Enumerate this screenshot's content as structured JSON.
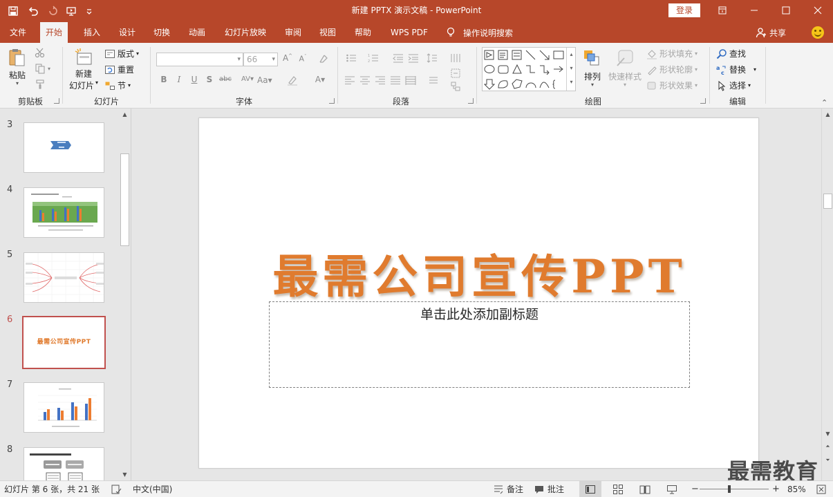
{
  "window": {
    "title": "新建 PPTX 演示文稿  -  PowerPoint",
    "login_label": "登录"
  },
  "tabs": [
    {
      "label": "文件"
    },
    {
      "label": "开始"
    },
    {
      "label": "插入"
    },
    {
      "label": "设计"
    },
    {
      "label": "切换"
    },
    {
      "label": "动画"
    },
    {
      "label": "幻灯片放映"
    },
    {
      "label": "审阅"
    },
    {
      "label": "视图"
    },
    {
      "label": "帮助"
    },
    {
      "label": "WPS PDF"
    }
  ],
  "tell_me_label": "操作说明搜索",
  "share_label": "共享",
  "ribbon": {
    "clipboard": {
      "paste": "粘贴",
      "group": "剪贴板"
    },
    "slides": {
      "new_slide_line1": "新建",
      "new_slide_line2": "幻灯片",
      "layout": "版式",
      "reset": "重置",
      "section": "节",
      "group": "幻灯片"
    },
    "font": {
      "size_value": "66",
      "group": "字体"
    },
    "paragraph": {
      "group": "段落"
    },
    "drawing": {
      "arrange": "排列",
      "quick_styles": "快速样式",
      "shape_fill": "形状填充",
      "shape_outline": "形状轮廓",
      "shape_effects": "形状效果",
      "group": "绘图"
    },
    "editing": {
      "find": "查找",
      "replace": "替换",
      "select": "选择",
      "group": "编辑"
    }
  },
  "thumbnails": [
    {
      "number": "3"
    },
    {
      "number": "4"
    },
    {
      "number": "5"
    },
    {
      "number": "6",
      "title": "最需公司宣传PPT"
    },
    {
      "number": "7"
    },
    {
      "number": "8"
    }
  ],
  "slide": {
    "title": "最需公司宣传PPT",
    "subtitle_placeholder": "单击此处添加副标题"
  },
  "watermark": "最需教育",
  "status": {
    "slide_info": "幻灯片 第 6 张，共 21 张",
    "language": "中文(中国)",
    "notes": "备注",
    "comments": "批注",
    "zoom": "85%"
  },
  "colors": {
    "accent": "#b7472a",
    "title_orange": "#e07b2e",
    "selected_thumb": "#c0504d"
  }
}
